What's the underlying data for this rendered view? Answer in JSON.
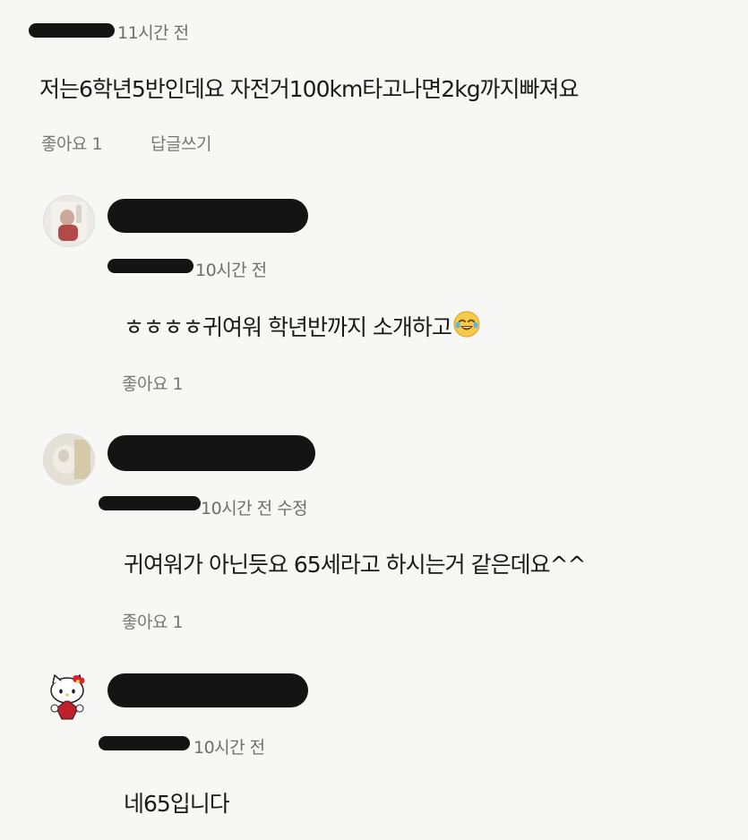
{
  "comments": [
    {
      "time": "11시간 전",
      "text": "저는6학년5반인데요 자전거100km타고나면2kg까지빠져요",
      "like_label": "좋아요 1",
      "reply_label": "답글쓰기"
    },
    {
      "time": "10시간 전",
      "text": "ㅎㅎㅎㅎ귀여워 학년반까지 소개하고",
      "like_label": "좋아요 1"
    },
    {
      "time": "10시간 전 수정",
      "text": "귀여워가 아닌듯요 65세라고 하시는거 같은데요^^",
      "like_label": "좋아요 1"
    },
    {
      "time": "10시간 전",
      "text": "네65입니다"
    }
  ],
  "icons": {
    "avatar_1": "profile-photo-icon",
    "avatar_2": "profile-photo-icon",
    "avatar_3": "hello-kitty-icon",
    "emoji": "smiling-face-with-tears-icon"
  }
}
